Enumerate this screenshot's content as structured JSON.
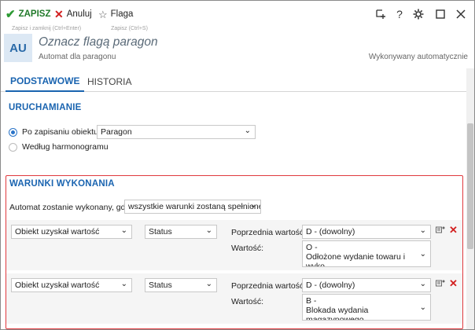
{
  "toolbar": {
    "save_label": "ZAPISZ",
    "cancel_label": "Anuluj",
    "flag_label": "Flaga",
    "save_tooltip": "Zapisz i zamknij (Ctrl+Enter)",
    "save_short_tooltip": "Zapisz (Ctrl+S)",
    "icons": [
      "add-icon",
      "help-icon",
      "gear-icon",
      "maximize-icon",
      "close-icon"
    ]
  },
  "header": {
    "avatar": "AU",
    "title": "Oznacz flagą paragon",
    "subtitle": "Automat dla paragonu",
    "execution": "Wykonywany automatycznie"
  },
  "tabs": [
    {
      "label": "PODSTAWOWE",
      "active": true
    },
    {
      "label": "HISTORIA",
      "active": false
    }
  ],
  "trigger": {
    "heading": "URUCHAMIANIE",
    "option_save": "Po zapisaniu obiektu",
    "option_save_object": "Paragon",
    "option_schedule": "Według harmonogramu"
  },
  "conditions": {
    "heading": "WARUNKI WYKONANIA",
    "run_when_label": "Automat zostanie wykonany, gdy",
    "run_when_value": "wszystkie warunki zostaną spełnione",
    "rows": [
      {
        "field": "Obiekt uzyskał wartość",
        "attribute": "Status",
        "prev_label": "Poprzednia wartość:",
        "prev_value": "D - (dowolny)",
        "value_label": "Wartość:",
        "value_line1": "O -",
        "value_line2": "Odłożone wydanie towaru i wyko"
      },
      {
        "field": "Obiekt uzyskał wartość",
        "attribute": "Status",
        "prev_label": "Poprzednia wartość:",
        "prev_value": "D - (dowolny)",
        "value_label": "Wartość:",
        "value_line1": "B -",
        "value_line2": "Blokada wydania magazynowego"
      }
    ]
  },
  "colors": {
    "accent": "#1a64b0",
    "save": "#2c9a33",
    "danger": "#d21f1f",
    "highlight_border": "#e0393e"
  }
}
